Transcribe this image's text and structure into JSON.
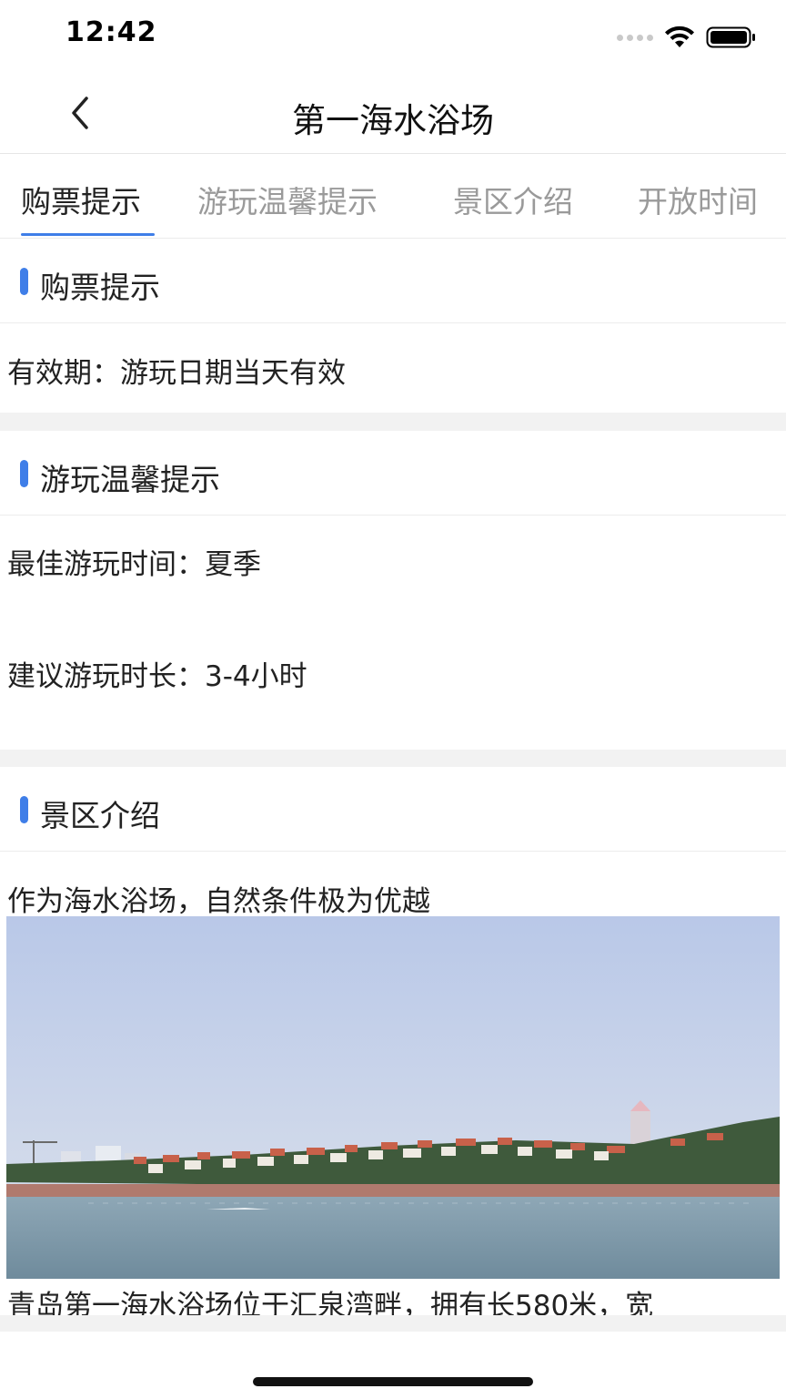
{
  "status_bar": {
    "time": "12:42"
  },
  "nav": {
    "title": "第一海水浴场"
  },
  "tabs": [
    {
      "label": "购票提示",
      "active": true
    },
    {
      "label": "游玩温馨提示",
      "active": false
    },
    {
      "label": "景区介绍",
      "active": false
    },
    {
      "label": "开放时间",
      "active": false
    }
  ],
  "sections": {
    "ticket": {
      "title": "购票提示",
      "validity": "有效期：游玩日期当天有效"
    },
    "tips": {
      "title": "游玩温馨提示",
      "best_time": "最佳游玩时间：夏季",
      "suggested_duration": "建议游玩时长：3-4小时"
    },
    "intro": {
      "title": "景区介绍",
      "summary": "作为海水浴场，自然条件极为优越",
      "description": "青岛第一海水浴场位于汇泉湾畔，拥有长580米，宽"
    }
  },
  "colors": {
    "accent": "#3f7ee8",
    "divider": "#f2f2f2",
    "tab_inactive": "#9a9a9a"
  },
  "icons": {
    "back": "chevron-left-icon",
    "wifi": "wifi-icon",
    "battery": "battery-icon",
    "signal": "signal-dots-icon"
  }
}
